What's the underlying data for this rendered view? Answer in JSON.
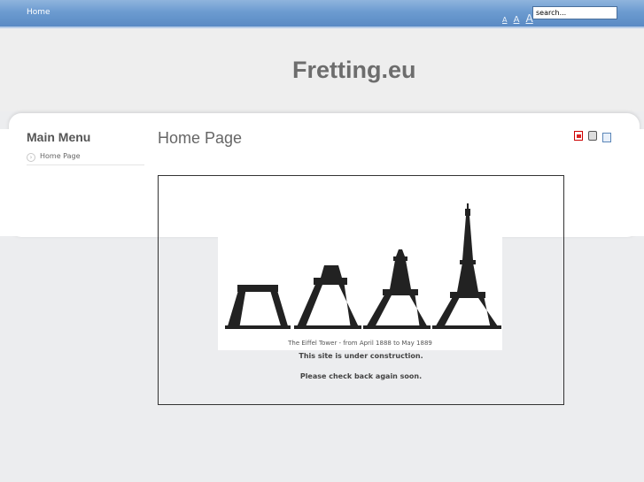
{
  "topbar": {
    "nav_home": "Home",
    "font_sizer": [
      "A",
      "A",
      "A"
    ],
    "search_value": "search..."
  },
  "header": {
    "site_title": "Fretting.eu"
  },
  "sidebar": {
    "title": "Main Menu",
    "items": [
      {
        "label": "Home Page"
      }
    ]
  },
  "main": {
    "heading": "Home Page",
    "icons": [
      "pdf-icon",
      "print-icon",
      "email-icon"
    ],
    "image_caption": "The Eiffel Tower - from April 1888 to May 1889",
    "notice_line_1": "This site is under construction.",
    "notice_line_2": "Please check back again soon."
  },
  "colors": {
    "topbar": "#6c9bd0",
    "title": "#6d6d6d",
    "background": "#ecedef"
  }
}
